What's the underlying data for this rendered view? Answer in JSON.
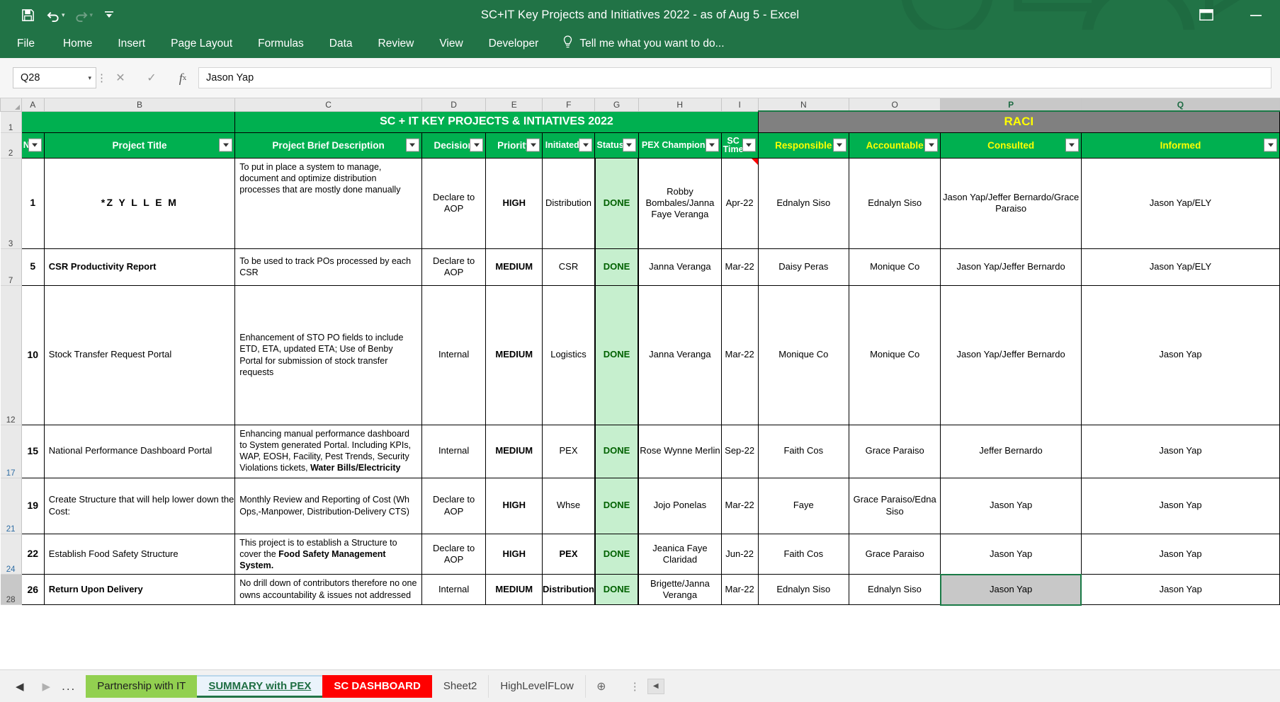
{
  "window": {
    "title": "SC+IT Key Projects and Initiatives 2022 - as of Aug 5 - Excel",
    "quick_access": [
      {
        "name": "save-icon",
        "label": "Save"
      },
      {
        "name": "undo-icon",
        "label": "Undo"
      },
      {
        "name": "redo-icon",
        "label": "Redo"
      },
      {
        "name": "customize-qat-icon",
        "label": "Customize Quick Access Toolbar"
      }
    ],
    "controls": [
      {
        "name": "ribbon-display-options-icon",
        "label": "Ribbon Display Options"
      },
      {
        "name": "minimize-icon",
        "label": "Minimize"
      }
    ]
  },
  "ribbon": {
    "tabs": [
      "File",
      "Home",
      "Insert",
      "Page Layout",
      "Formulas",
      "Data",
      "Review",
      "View",
      "Developer"
    ],
    "tell_me": "Tell me what you want to do..."
  },
  "formula_bar": {
    "name_box": "Q28",
    "cancel_label": "Cancel",
    "enter_label": "Enter",
    "fx_label": "fx",
    "formula_value": "Jason Yap"
  },
  "grid": {
    "column_letters": [
      "A",
      "B",
      "C",
      "D",
      "E",
      "F",
      "G",
      "H",
      "I",
      "N",
      "O",
      "P",
      "Q"
    ],
    "selected_columns": [
      "P",
      "Q"
    ],
    "row_numbers": [
      "1",
      "2",
      "3",
      "7",
      "12",
      "17",
      "21",
      "24",
      "28"
    ],
    "banner": {
      "main_title": "SC + IT KEY PROJECTS & INTIATIVES 2022",
      "raci_title": "RACI"
    },
    "headers": [
      {
        "label": "N",
        "key": "no"
      },
      {
        "label": "Project Title",
        "key": "title"
      },
      {
        "label": "Project Brief Description",
        "key": "desc"
      },
      {
        "label": "Decision",
        "key": "decision"
      },
      {
        "label": "Priority",
        "key": "priority"
      },
      {
        "label": "Initiated",
        "key": "initiated"
      },
      {
        "label": "Status",
        "key": "status"
      },
      {
        "label": "PEX Champion",
        "key": "pex"
      },
      {
        "label": "SC",
        "label2": "Time",
        "key": "sctime"
      },
      {
        "label": "Responsible",
        "key": "responsible"
      },
      {
        "label": "Accountable",
        "key": "accountable"
      },
      {
        "label": "Consulted",
        "key": "consulted"
      },
      {
        "label": "Informed",
        "key": "informed"
      }
    ],
    "rows": [
      {
        "no": "1",
        "title": "*Z Y L L E M",
        "desc": "To put in place a system to manage, document and optimize distribution processes that are mostly done manually",
        "decision": "Declare to AOP",
        "priority": "HIGH",
        "initiated": "Distribution",
        "status": "DONE",
        "pex": "Robby Bombales/Janna Faye Veranga",
        "sctime": "Apr-22",
        "responsible": "Ednalyn Siso",
        "accountable": "Ednalyn Siso",
        "consulted": "Jason Yap/Jeffer Bernardo/Grace Paraiso",
        "informed": "Jason Yap/ELY"
      },
      {
        "no": "5",
        "title": "CSR Productivity Report",
        "desc": "To be used to track POs processed by each CSR",
        "decision": "Declare to AOP",
        "priority": "MEDIUM",
        "initiated": "CSR",
        "status": "DONE",
        "pex": "Janna Veranga",
        "sctime": "Mar-22",
        "responsible": "Daisy Peras",
        "accountable": "Monique Co",
        "consulted": "Jason Yap/Jeffer Bernardo",
        "informed": "Jason Yap/ELY"
      },
      {
        "no": "10",
        "title": "Stock Transfer Request Portal",
        "desc": "Enhancement of STO PO fields to include ETD, ETA, updated ETA; Use of Benby Portal for submission of stock transfer requests",
        "decision": "Internal",
        "priority": "MEDIUM",
        "initiated": "Logistics",
        "status": "DONE",
        "pex": "Janna Veranga",
        "sctime": "Mar-22",
        "responsible": "Monique Co",
        "accountable": "Monique Co",
        "consulted": "Jason Yap/Jeffer Bernardo",
        "informed": "Jason Yap"
      },
      {
        "no": "15",
        "title": "National Performance Dashboard Portal",
        "desc": "Enhancing manual performance dashboard to System generated Portal. Including KPIs, WAP, EOSH, Facility, Pest Trends, Security Violations tickets, ",
        "desc_bold": "Water Bills/Electricity",
        "decision": "Internal",
        "priority": "MEDIUM",
        "initiated": "PEX",
        "status": "DONE",
        "pex": "Rose Wynne Merlin",
        "sctime": "Sep-22",
        "responsible": "Faith Cos",
        "accountable": "Grace Paraiso",
        "consulted": "Jeffer Bernardo",
        "informed": "Jason Yap"
      },
      {
        "no": "19",
        "title": "Create Structure that will help lower down the Cost:",
        "desc": "Monthly Review and Reporting of Cost (Wh Ops,-Manpower, Distribution-Delivery CTS)",
        "decision": "Declare to AOP",
        "priority": "HIGH",
        "initiated": "Whse",
        "status": "DONE",
        "pex": "Jojo Ponelas",
        "sctime": "Mar-22",
        "responsible": "Faye",
        "accountable": "Grace Paraiso/Edna Siso",
        "consulted": "Jason Yap",
        "informed": "Jason Yap"
      },
      {
        "no": "22",
        "title": "Establish Food Safety Structure",
        "desc": "This project is to establish a Structure to cover the ",
        "desc_bold": "Food Safety Management System.",
        "decision": "Declare to AOP",
        "priority": "HIGH",
        "initiated": "PEX",
        "status": "DONE",
        "pex": "Jeanica Faye Claridad",
        "sctime": "Jun-22",
        "responsible": "Faith Cos",
        "accountable": "Grace Paraiso",
        "consulted": "Jason Yap",
        "informed": "Jason Yap"
      },
      {
        "no": "26",
        "title": "Return Upon Delivery",
        "desc": "No drill down of contributors therefore no one owns accountability & issues not addressed",
        "decision": "Internal",
        "priority": "MEDIUM",
        "initiated": "Distribution",
        "status": "DONE",
        "pex": "Brigette/Janna Veranga",
        "sctime": "Mar-22",
        "responsible": "Ednalyn Siso",
        "accountable": "Ednalyn Siso",
        "consulted": "Jason Yap",
        "informed": "Jason Yap"
      }
    ]
  },
  "sheet_tabs": {
    "nav": {
      "prev": "◀",
      "next": "▶",
      "more": "..."
    },
    "tabs": [
      {
        "label": "Partnership with IT",
        "style": "green"
      },
      {
        "label": "SUMMARY with PEX",
        "style": "active"
      },
      {
        "label": "SC DASHBOARD",
        "style": "red"
      },
      {
        "label": "Sheet2",
        "style": "plain"
      },
      {
        "label": "HighLevelFLow",
        "style": "plain"
      }
    ],
    "add_label": "⊕"
  },
  "colors": {
    "excel_green": "#217346",
    "header_green": "#00b050",
    "raci_gray": "#808080",
    "status_green_bg": "#c6efce",
    "status_green_fg": "#006100",
    "tab_green": "#92d050",
    "tab_red": "#ff0000",
    "yellow_text": "#ffff00"
  }
}
